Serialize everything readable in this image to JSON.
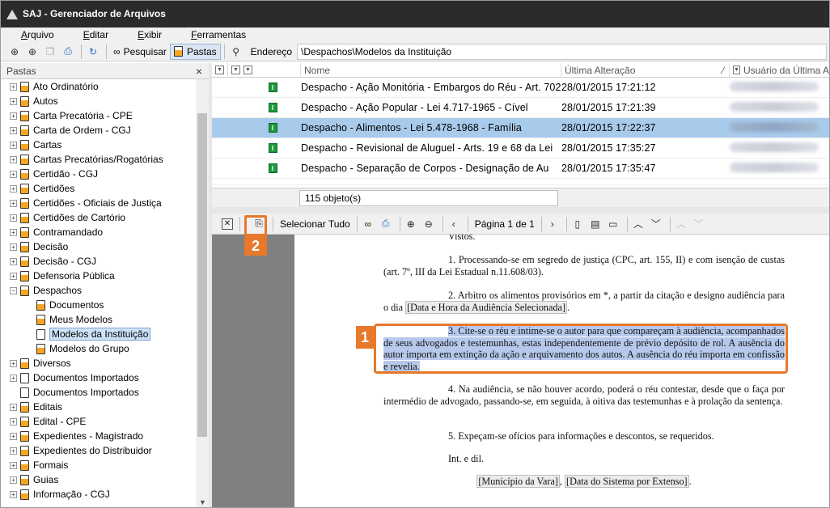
{
  "window": {
    "title": "SAJ - Gerenciador de Arquivos"
  },
  "menu": [
    {
      "pre": "",
      "u": "A",
      "post": "rquivo"
    },
    {
      "pre": "",
      "u": "E",
      "post": "ditar"
    },
    {
      "pre": "",
      "u": "E",
      "post": "xibir"
    },
    {
      "pre": "",
      "u": "F",
      "post": "erramentas"
    }
  ],
  "toolbar": {
    "pesquisar_label": "Pesquisar",
    "pastas_label": "Pastas",
    "endereco_label": "Endereço",
    "address_value": "\\Despachos\\Modelos da Instituição"
  },
  "folders_panel": {
    "title": "Pastas",
    "close_glyph": "×",
    "items": [
      {
        "label": "Ato Ordinatório",
        "level": 0,
        "expander": "+"
      },
      {
        "label": "Autos",
        "level": 0,
        "expander": "+"
      },
      {
        "label": "Carta Precatória - CPE",
        "level": 0,
        "expander": "+"
      },
      {
        "label": "Carta de Ordem - CGJ",
        "level": 0,
        "expander": "+"
      },
      {
        "label": "Cartas",
        "level": 0,
        "expander": "+"
      },
      {
        "label": "Cartas Precatórias/Rogatórias",
        "level": 0,
        "expander": "+"
      },
      {
        "label": "Certidão - CGJ",
        "level": 0,
        "expander": "+"
      },
      {
        "label": "Certidões",
        "level": 0,
        "expander": "+"
      },
      {
        "label": "Certidões - Oficiais de Justiça",
        "level": 0,
        "expander": "+"
      },
      {
        "label": "Certidões de Cartório",
        "level": 0,
        "expander": "+"
      },
      {
        "label": "Contramandado",
        "level": 0,
        "expander": "+"
      },
      {
        "label": "Decisão",
        "level": 0,
        "expander": "+"
      },
      {
        "label": "Decisão - CGJ",
        "level": 0,
        "expander": "+"
      },
      {
        "label": "Defensoria Pública",
        "level": 0,
        "expander": "+"
      },
      {
        "label": "Despachos",
        "level": 0,
        "expander": "−"
      },
      {
        "label": "Documentos",
        "level": 1,
        "expander": ""
      },
      {
        "label": "Meus Modelos",
        "level": 1,
        "expander": ""
      },
      {
        "label": "Modelos da Instituição",
        "level": 1,
        "expander": "",
        "selected": true,
        "plain": true
      },
      {
        "label": "Modelos do Grupo",
        "level": 1,
        "expander": ""
      },
      {
        "label": "Diversos",
        "level": 0,
        "expander": "+"
      },
      {
        "label": "Documentos Importados",
        "level": 0,
        "expander": "+",
        "plain": true
      },
      {
        "label": "Documentos Importados",
        "level": 0,
        "expander": "",
        "plain": true
      },
      {
        "label": "Editais",
        "level": 0,
        "expander": "+"
      },
      {
        "label": "Edital - CPE",
        "level": 0,
        "expander": "+"
      },
      {
        "label": "Expedientes - Magistrado",
        "level": 0,
        "expander": "+"
      },
      {
        "label": "Expedientes do Distribuidor",
        "level": 0,
        "expander": "+"
      },
      {
        "label": "Formais",
        "level": 0,
        "expander": "+"
      },
      {
        "label": "Guias",
        "level": 0,
        "expander": "+"
      },
      {
        "label": "Informação - CGJ",
        "level": 0,
        "expander": "+"
      }
    ]
  },
  "grid": {
    "headers": {
      "name": "Nome",
      "date": "Última Alteração",
      "user": "Usuário da Última Alteração"
    },
    "rows": [
      {
        "name": "Despacho - Ação Monitória - Embargos do Réu - Art. 702",
        "date": "28/01/2015 17:21:12",
        "selected": false
      },
      {
        "name": "Despacho - Ação Popular - Lei 4.717-1965 - Cível",
        "date": "28/01/2015 17:21:39",
        "selected": false
      },
      {
        "name": "Despacho - Alimentos - Lei 5.478-1968 - Família",
        "date": "28/01/2015 17:22:37",
        "selected": true
      },
      {
        "name": "Despacho - Revisional de Aluguel - Arts. 19 e 68 da Lei",
        "date": "28/01/2015 17:35:27",
        "selected": false
      },
      {
        "name": "Despacho - Separação de Corpos - Designação de Au",
        "date": "28/01/2015 17:35:47",
        "selected": false
      }
    ],
    "count_label": "115 objeto(s)"
  },
  "viewer_toolbar": {
    "select_all_label": "Selecionar Tudo",
    "page_label": "Página 1 de 1"
  },
  "callouts": {
    "one": "1",
    "two": "2"
  },
  "document": {
    "partial_top": "Vistos.",
    "p1": "1. Processando-se em segredo de justiça (CPC, art. 155, II) e com isenção de custas (art. 7º, III da Lei Estadual n.11.608/03).",
    "p2_a": "2. Arbitro os alimentos provisórios em *, a partir da citação e designo audiência para o dia ",
    "p2_field": "[Data e Hora da Audiência Selecionada]",
    "p2_b": ".",
    "p3": "3. Cite-se o réu e intime-se o autor para que compareçam à audiência, acompanhados de seus advogados e testemunhas, estas independentemente de prévio depósito de rol. A ausência do autor importa em extinção da ação e arquivamento dos autos. A ausência do réu importa em confissão e revelia.",
    "p4": "4. Na audiência, se não houver acordo, poderá o réu contestar, desde que o faça por intermédio de advogado, passando-se, em seguida, à oitiva das testemunhas e à prolação da sentença.",
    "p5": "5. Expeçam-se ofícios para informações e descontos, se requeridos.",
    "p6": "Int. e dil.",
    "footer_field1": "[Município da Vara]",
    "footer_sep": ", ",
    "footer_field2": "[Data do Sistema por Extenso]",
    "footer_end": "."
  }
}
